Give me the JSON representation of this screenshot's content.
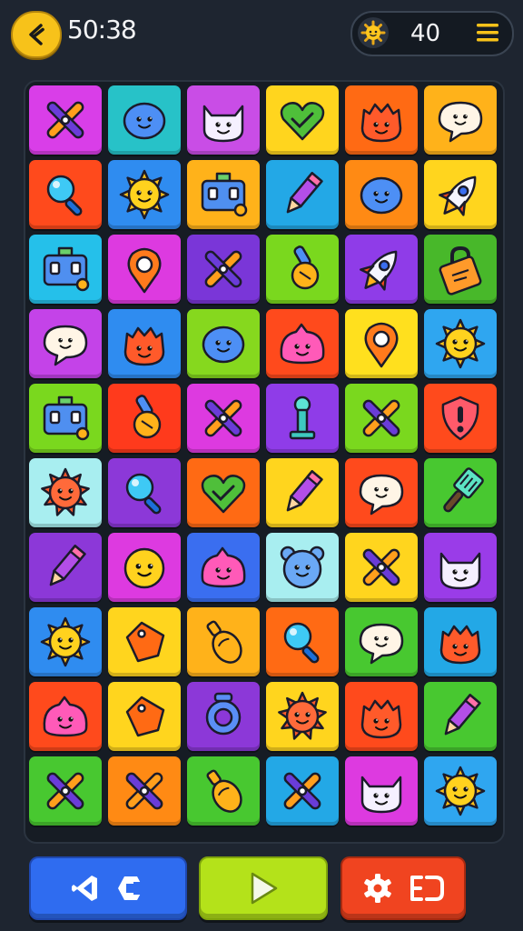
{
  "header": {
    "timer": "50:38",
    "score": "40"
  },
  "icons": {
    "back": "back-arrow-icon",
    "coin": "sun-coin-icon",
    "menu": "hamburger-menu-icon"
  },
  "board": {
    "tiles": [
      [
        {
          "c": "#d93ee8",
          "i": "crossed-sticks"
        },
        {
          "c": "#27c2c8",
          "i": "blob-face"
        },
        {
          "c": "#c94de6",
          "i": "cat-face"
        },
        {
          "c": "#ffd51e",
          "i": "heart"
        },
        {
          "c": "#ff6a14",
          "i": "monster-face"
        },
        {
          "c": "#ffb21a",
          "i": "speech-face"
        }
      ],
      [
        {
          "c": "#ff4a1c",
          "i": "magnifier"
        },
        {
          "c": "#2f8cf0",
          "i": "sun-face"
        },
        {
          "c": "#ffb21a",
          "i": "robot"
        },
        {
          "c": "#23a8e6",
          "i": "pencil"
        },
        {
          "c": "#ff8a14",
          "i": "blob-face"
        },
        {
          "c": "#ffd51e",
          "i": "rocket"
        }
      ],
      [
        {
          "c": "#25c0ea",
          "i": "robot"
        },
        {
          "c": "#dd3ae0",
          "i": "pin"
        },
        {
          "c": "#7a36d8",
          "i": "crossed-sticks"
        },
        {
          "c": "#7ad81e",
          "i": "brush"
        },
        {
          "c": "#8f3ce8",
          "i": "rocket"
        },
        {
          "c": "#48b82a",
          "i": "lock"
        }
      ],
      [
        {
          "c": "#c443e8",
          "i": "speech-face"
        },
        {
          "c": "#2f8cf0",
          "i": "monster-face"
        },
        {
          "c": "#86d81e",
          "i": "blob-face"
        },
        {
          "c": "#ff4a1c",
          "i": "slime-face"
        },
        {
          "c": "#ffe01e",
          "i": "pin"
        },
        {
          "c": "#2fa6f0",
          "i": "sun-face"
        }
      ],
      [
        {
          "c": "#7ad81e",
          "i": "robot"
        },
        {
          "c": "#ff3a1c",
          "i": "brush"
        },
        {
          "c": "#dd3ae0",
          "i": "crossed-sticks"
        },
        {
          "c": "#8f3ce8",
          "i": "pillar"
        },
        {
          "c": "#7ad81e",
          "i": "crossed-sticks"
        },
        {
          "c": "#ff4a1c",
          "i": "shield"
        }
      ],
      [
        {
          "c": "#a8eef0",
          "i": "star-face"
        },
        {
          "c": "#8c38d8",
          "i": "magnifier"
        },
        {
          "c": "#ff6a14",
          "i": "heart"
        },
        {
          "c": "#ffd51e",
          "i": "pencil"
        },
        {
          "c": "#ff4a1c",
          "i": "speech-face"
        },
        {
          "c": "#48c830",
          "i": "spatula"
        }
      ],
      [
        {
          "c": "#8c38d8",
          "i": "pencil"
        },
        {
          "c": "#dd3ae0",
          "i": "smile-face"
        },
        {
          "c": "#3a6ef0",
          "i": "slime-face"
        },
        {
          "c": "#a8eef0",
          "i": "bear-face"
        },
        {
          "c": "#ffd51e",
          "i": "crossed-sticks"
        },
        {
          "c": "#9a3ce8",
          "i": "cat-face"
        }
      ],
      [
        {
          "c": "#2f8cf0",
          "i": "sun-face"
        },
        {
          "c": "#ffd51e",
          "i": "tag"
        },
        {
          "c": "#ffb21a",
          "i": "bottle"
        },
        {
          "c": "#ff6a14",
          "i": "magnifier"
        },
        {
          "c": "#48c830",
          "i": "speech-face"
        },
        {
          "c": "#23a8e6",
          "i": "monster-face"
        }
      ],
      [
        {
          "c": "#ff4a1c",
          "i": "slime-face"
        },
        {
          "c": "#ffd51e",
          "i": "tag"
        },
        {
          "c": "#8c38d8",
          "i": "ring"
        },
        {
          "c": "#ffd51e",
          "i": "star-face"
        },
        {
          "c": "#ff4a1c",
          "i": "monster-face"
        },
        {
          "c": "#48c830",
          "i": "pencil"
        }
      ],
      [
        {
          "c": "#48c830",
          "i": "crossed-sticks"
        },
        {
          "c": "#ff8a14",
          "i": "crossed-sticks"
        },
        {
          "c": "#48c830",
          "i": "bottle"
        },
        {
          "c": "#23a8e6",
          "i": "crossed-sticks"
        },
        {
          "c": "#dd3ae0",
          "i": "cat-face"
        },
        {
          "c": "#2fa6f0",
          "i": "sun-face"
        }
      ]
    ]
  },
  "controls": {
    "left_icons": [
      "vs-code-icon",
      "nut-icon"
    ],
    "center_icon": "play-icon",
    "right_icons": [
      "gear-icon",
      "exit-icon"
    ]
  }
}
